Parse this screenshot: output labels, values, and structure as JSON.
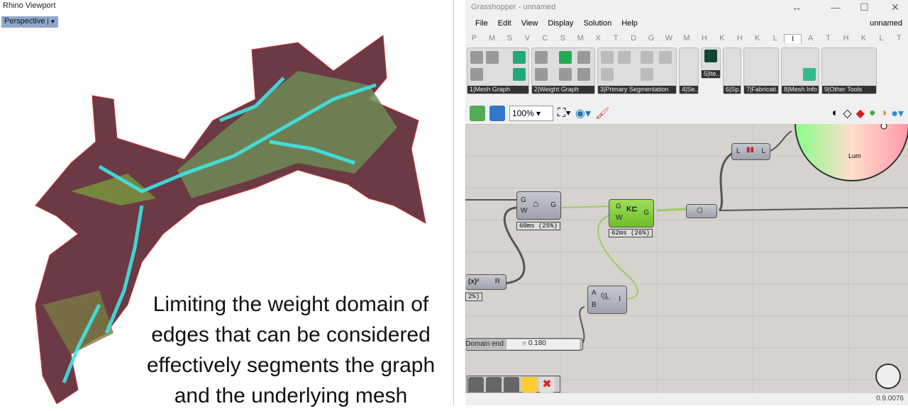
{
  "rhino": {
    "title": "Rhino Viewport",
    "viewport_label": "Perspective"
  },
  "caption": [
    "Limiting the weight domain of",
    "edges that can be considered",
    "effectively segments the graph",
    "and the underlying mesh"
  ],
  "grasshopper": {
    "title": "Grasshopper - unnamed",
    "menu": [
      "File",
      "Edit",
      "View",
      "Display",
      "Solution",
      "Help"
    ],
    "doc_name": "unnamed",
    "tabs": [
      "P",
      "M",
      "S",
      "V",
      "C",
      "S",
      "M",
      "X",
      "T",
      "D",
      "G",
      "W",
      "M",
      "H",
      "K",
      "H",
      "K",
      "L",
      "I",
      "A",
      "T",
      "H",
      "K",
      "L",
      "T"
    ],
    "selected_tab": "I",
    "groups": [
      "1|Mesh Graph",
      "2|Weight Graph",
      "3|Primary Segmentation",
      "4|Se...",
      "5|Ite...",
      "6|Sp...",
      "7|Fabricati...",
      "8|Mesh Info",
      "9|Other Tools"
    ],
    "zoom": "100%",
    "components": {
      "weight": {
        "in": [
          "G",
          "W"
        ],
        "out": "G",
        "time": "60ms (25%)"
      },
      "kgraph": {
        "in": [
          "G",
          "W"
        ],
        "out": "G",
        "time": "62ms (26%)"
      },
      "domain": {
        "in": [
          "A",
          "B"
        ],
        "out": "I"
      },
      "expr": {
        "label": "(x)²",
        "out": "R",
        "time": "2%)"
      },
      "lum": {
        "in": "L",
        "out": "L"
      },
      "slider": {
        "label": "Domain end",
        "value": "0.180"
      },
      "wheel_label": "Lum"
    },
    "version": "0.9.0076"
  }
}
